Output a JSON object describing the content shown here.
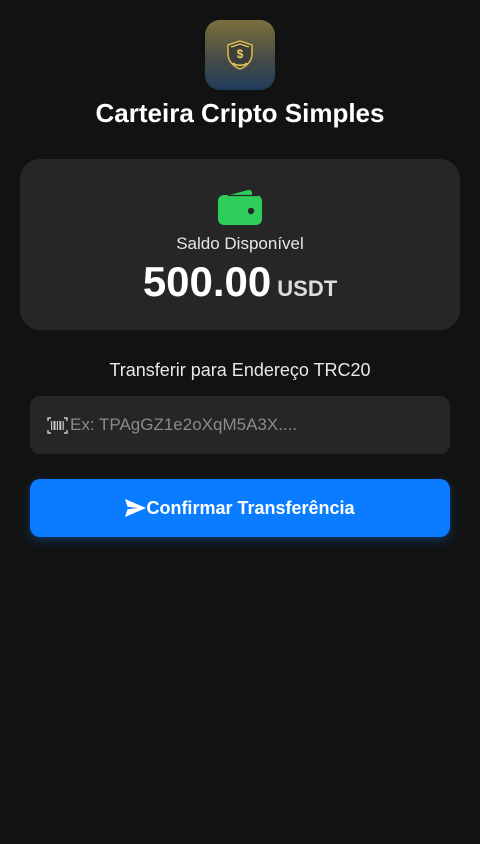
{
  "app": {
    "title": "Carteira Cripto Simples",
    "logo_icon": "shield-dollar-icon"
  },
  "balance": {
    "icon": "wallet-icon",
    "label": "Saldo Disponível",
    "amount": "500.00",
    "currency": "USDT"
  },
  "transfer": {
    "label": "Transferir para Endereço TRC20",
    "address_value": "",
    "address_placeholder": "Ex: TPAgGZ1e2oXqM5A3X....",
    "scan_icon": "barcode-scan-icon",
    "confirm_label": "Confirmar Transferência",
    "confirm_icon": "send-icon"
  },
  "colors": {
    "background": "#121212",
    "card": "#262626",
    "accent": "#0a7cff",
    "wallet_green": "#2ecc5a",
    "logo_gold": "#d8b24a"
  }
}
